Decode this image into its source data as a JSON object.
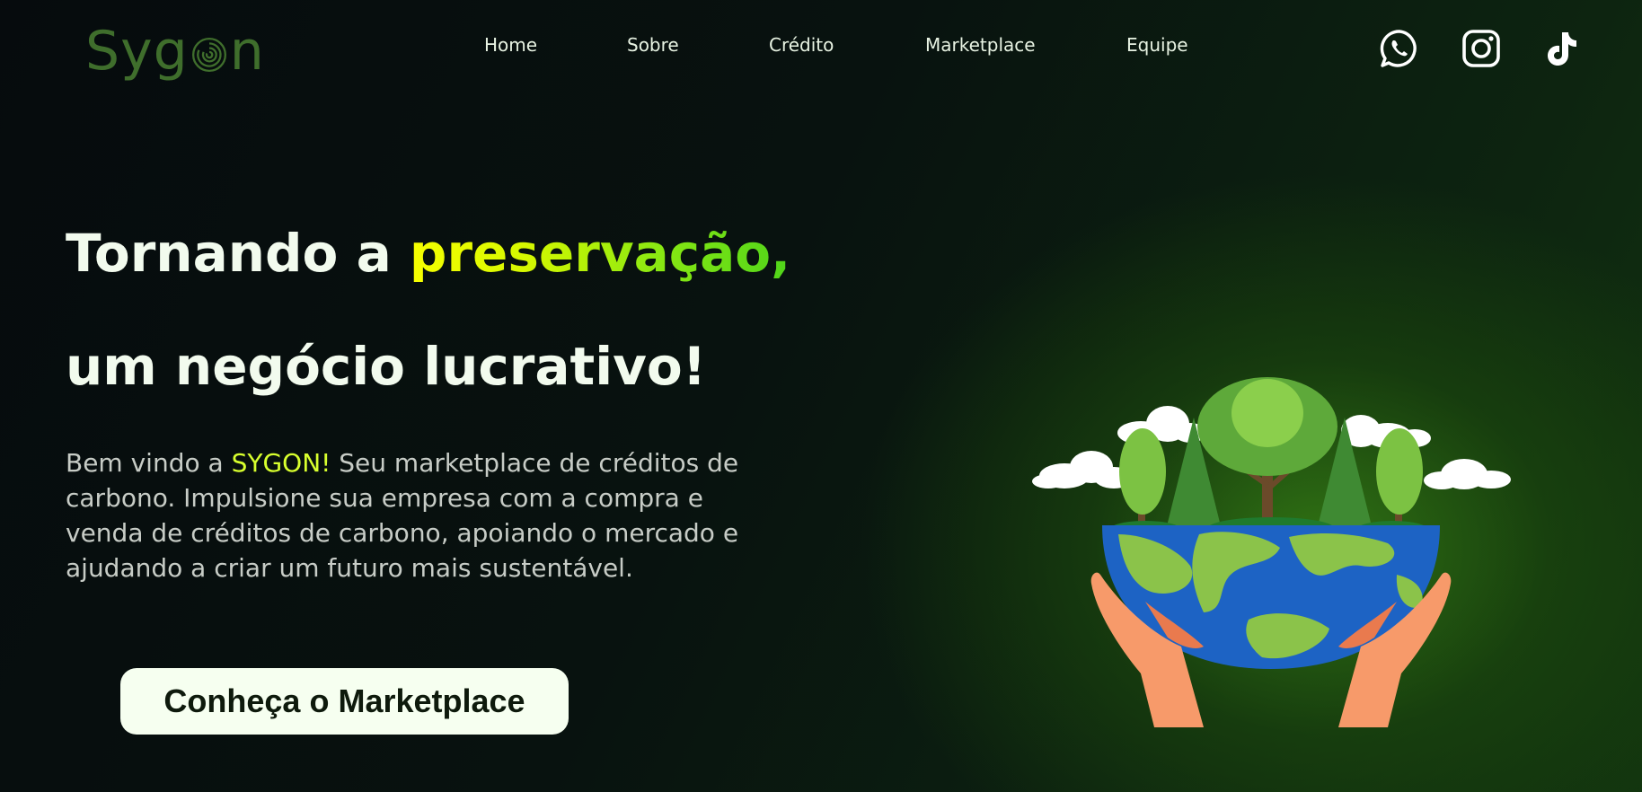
{
  "header": {
    "logo": {
      "prefix": "Syg",
      "suffix": "n"
    },
    "nav": [
      {
        "label": "Home"
      },
      {
        "label": "Sobre"
      },
      {
        "label": "Crédito"
      },
      {
        "label": "Marketplace"
      },
      {
        "label": "Equipe"
      }
    ],
    "social": [
      "whatsapp-icon",
      "instagram-icon",
      "tiktok-icon"
    ]
  },
  "hero": {
    "title_line1_prefix": "Tornando a ",
    "title_line1_highlight": "preservação,",
    "title_line2": "um negócio lucrativo!",
    "text_prefix": "Bem vindo a ",
    "text_highlight": "SYGON!",
    "text_body": " Seu marketplace de créditos de carbono. Impulsione sua empresa com a compra e venda de créditos de carbono, apoiando o mercado e ajudando a criar um futuro mais sustentável.",
    "cta_label": "Conheça o Marketplace"
  },
  "colors": {
    "brand_green": "#3f6e2c",
    "highlight_yellow": "#d8ff2e",
    "cta_background": "#f6fff0"
  }
}
